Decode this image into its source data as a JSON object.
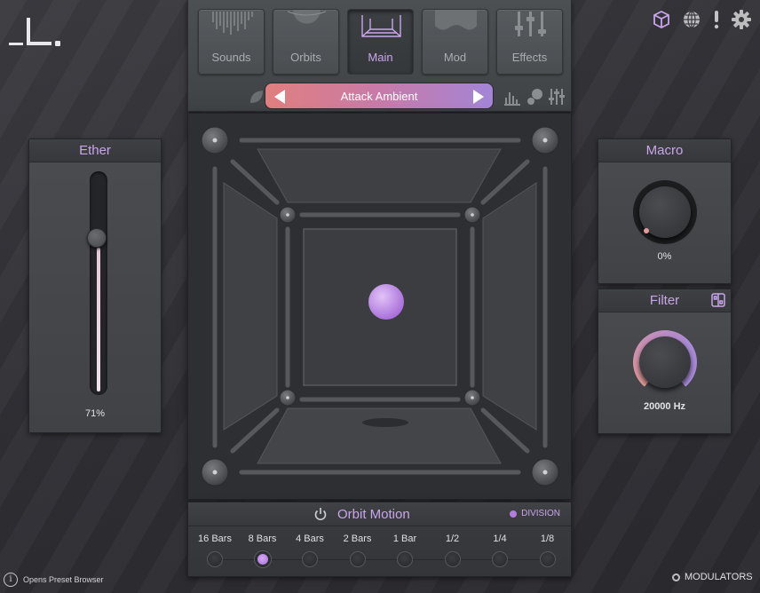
{
  "tabs": [
    {
      "label": "Sounds",
      "icon": "sounds-waveform-icon"
    },
    {
      "label": "Orbits",
      "icon": "orbits-planet-icon"
    },
    {
      "label": "Main",
      "icon": "main-room-icon"
    },
    {
      "label": "Mod",
      "icon": "mod-wave-icon"
    },
    {
      "label": "Effects",
      "icon": "effects-sliders-icon"
    }
  ],
  "active_tab": "Main",
  "preset": {
    "name": "Attack Ambient"
  },
  "header_icons": [
    "cube-icon",
    "globe-icon",
    "exclamation-icon",
    "gear-icon"
  ],
  "ether": {
    "title": "Ether",
    "value": "71%",
    "level": 0.71
  },
  "macro": {
    "title": "Macro",
    "value": "0%"
  },
  "filter": {
    "title": "Filter",
    "value": "20000 Hz"
  },
  "orbit_motion": {
    "title": "Orbit Motion",
    "division_label": "DIVISION",
    "divisions": [
      "16 Bars",
      "8 Bars",
      "4 Bars",
      "2 Bars",
      "1 Bar",
      "1/2",
      "1/4",
      "1/8"
    ],
    "selected": "8 Bars"
  },
  "footer": {
    "status": "Opens Preset Browser",
    "modulators": "MODULATORS"
  },
  "colors": {
    "accent": "#c9a6ec",
    "orb": "#b982e6",
    "preset_start": "#e07f7e",
    "preset_end": "#a285d6"
  }
}
